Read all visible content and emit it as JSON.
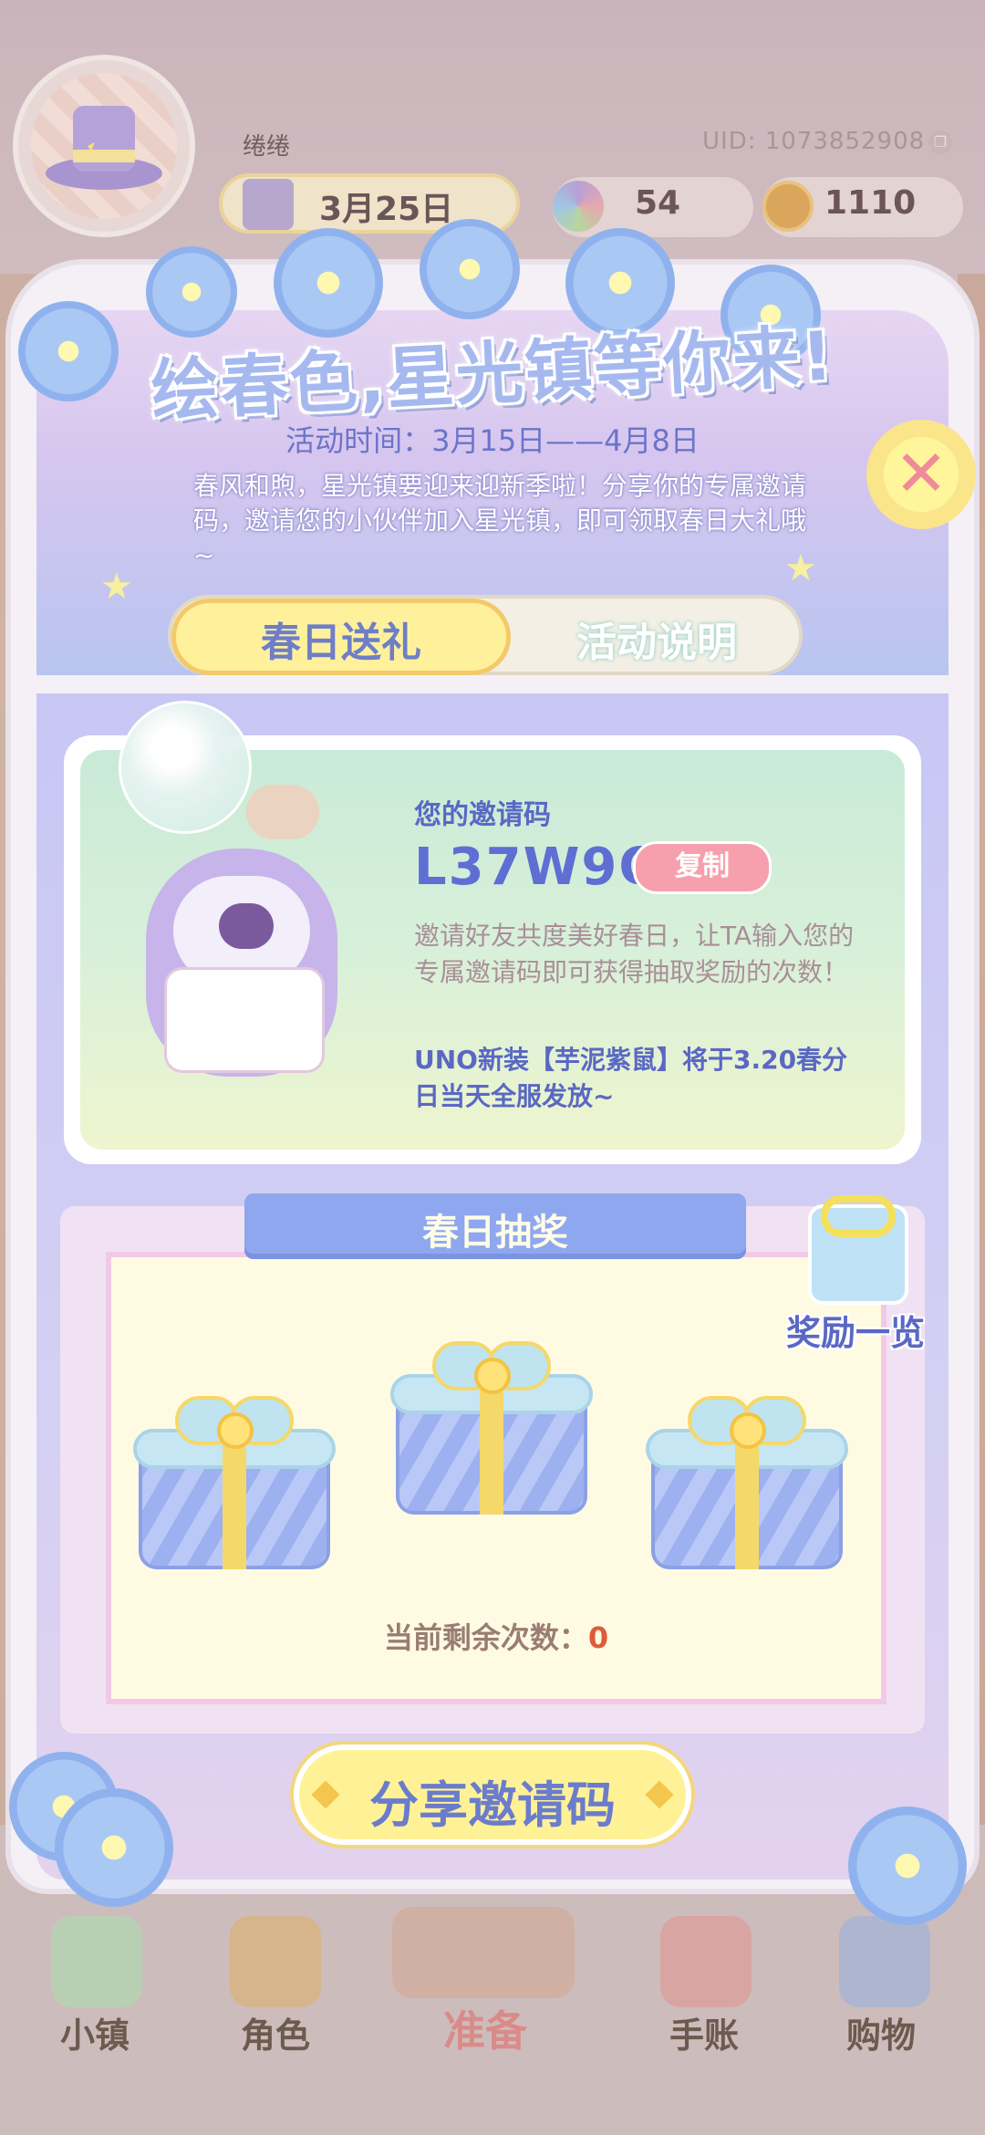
{
  "player": {
    "name": "绻绻",
    "uid": "UID: 1073852908",
    "date": "3月25日",
    "gems": "54",
    "coins": "1110"
  },
  "event": {
    "title": "绘春色,星光镇等你来!",
    "time": "活动时间：3月15日——4月8日",
    "description": "春风和煦，星光镇要迎来迎新季啦！分享你的专属邀请码，邀请您的小伙伴加入星光镇，即可领取春日大礼哦~",
    "close": "✕"
  },
  "tabs": {
    "gift": "春日送礼",
    "rules": "活动说明"
  },
  "invite": {
    "heading": "您的邀请码",
    "code": "L37W9Q",
    "copy": "复制",
    "description": "邀请好友共度美好春日，让TA输入您的专属邀请码即可获得抽取奖励的次数！",
    "note": "UNO新装【芋泥紫鼠】将于3.20春分日当天全服发放~"
  },
  "lottery": {
    "title": "春日抽奖",
    "reward_list": "奖励一览",
    "remaining_label": "当前剩余次数：",
    "remaining_count": "0"
  },
  "share_button": "分享邀请码",
  "nav": {
    "town": "小镇",
    "character": "角色",
    "prepare": "准备",
    "journal": "手账",
    "shopping": "购物"
  },
  "colors": {
    "accent_blue": "#5f6ed2",
    "copy_pink": "#f7a0ad",
    "button_yellow": "#fff296",
    "count_red": "#e05a3a"
  },
  "icons": [
    "avatar-hat-icon",
    "calendar-icon",
    "gem-icon",
    "coin-icon",
    "close-icon",
    "gift-box-icon",
    "reward-gift-icon",
    "town-icon",
    "character-icon",
    "prepare-icon",
    "journal-icon",
    "shopping-icon"
  ]
}
